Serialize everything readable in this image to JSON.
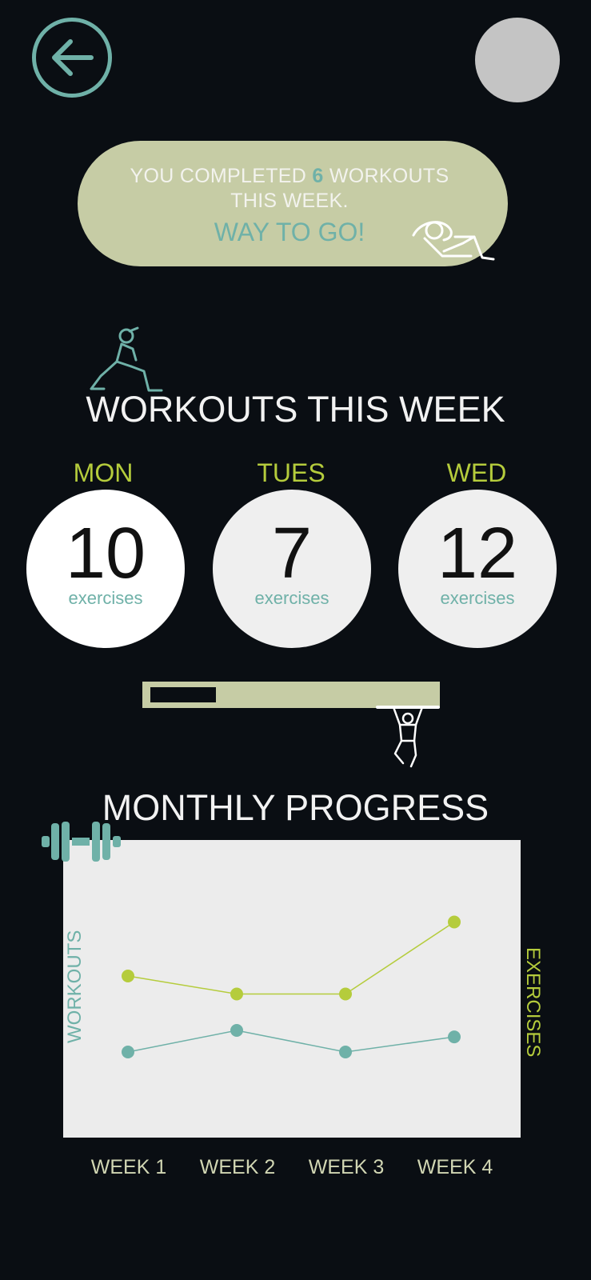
{
  "header": {
    "back_icon": "arrow-left-icon",
    "avatar": "user-avatar"
  },
  "banner": {
    "line1_prefix": "YOU COMPLETED ",
    "count": "6",
    "line1_suffix": " WORKOUTS",
    "line2": "THIS WEEK.",
    "cheer": "WAY TO GO!",
    "icon": "situp-figure-icon"
  },
  "weekly": {
    "title": "WORKOUTS THIS WEEK",
    "icon": "lunge-figure-icon",
    "days": [
      {
        "day": "MON",
        "value": "10",
        "unit": "exercises"
      },
      {
        "day": "TUES",
        "value": "7",
        "unit": "exercises"
      },
      {
        "day": "WED",
        "value": "12",
        "unit": "exercises"
      }
    ],
    "scroll_progress": 0.22,
    "hang_icon": "pullup-figure-icon"
  },
  "monthly": {
    "title": "MONTHLY PROGRESS",
    "icon": "dumbbell-icon"
  },
  "colors": {
    "accent_teal": "#6fb1a8",
    "accent_lime": "#b5cc3c",
    "banner_bg": "#c6cca5"
  },
  "chart_data": {
    "type": "line",
    "categories": [
      "WEEK 1",
      "WEEK 2",
      "WEEK 3",
      "WEEK 4"
    ],
    "ylabel_left": "WORKOUTS",
    "ylabel_right": "EXERCISES",
    "series": [
      {
        "name": "EXERCISES",
        "values": [
          28,
          25,
          25,
          37
        ],
        "color": "#b5cc3c"
      },
      {
        "name": "WORKOUTS",
        "values": [
          5,
          6,
          5,
          5.7
        ],
        "color": "#6fb1a8"
      }
    ]
  }
}
